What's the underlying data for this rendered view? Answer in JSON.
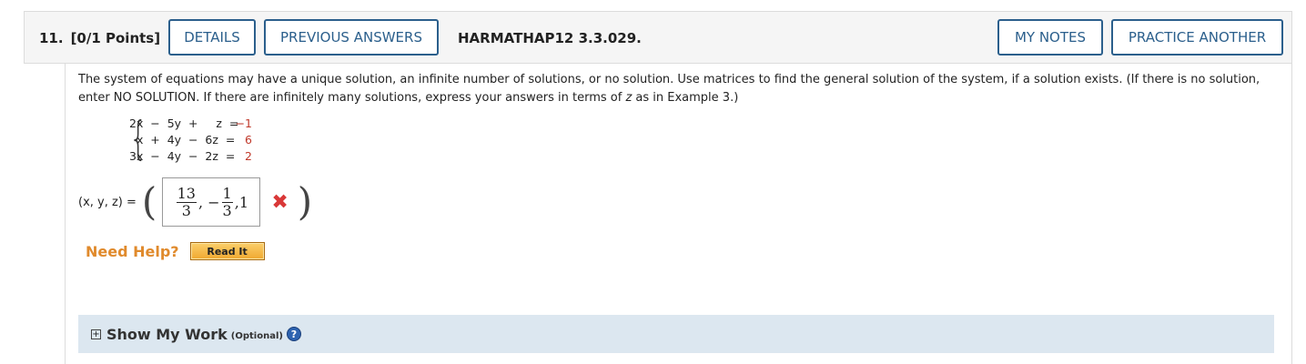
{
  "header": {
    "question_number": "11.",
    "points": "[0/1 Points]",
    "details_label": "DETAILS",
    "previous_answers_label": "PREVIOUS ANSWERS",
    "code": "HARMATHAP12 3.3.029.",
    "my_notes_label": "MY NOTES",
    "practice_another_label": "PRACTICE ANOTHER"
  },
  "prompt": {
    "text_1": "The system of equations may have a unique solution, an infinite number of solutions, or no solution. Use matrices to find the general solution of the system, if a solution exists. (If there is no solution, enter NO SOLUTION. If there are infinitely many solutions, express your answers in terms of ",
    "var": "z",
    "text_2": " as in Example 3.)"
  },
  "system": {
    "equations": [
      {
        "lhs": "2x  −  5y  +     z  =",
        "rhs": "−1"
      },
      {
        "lhs": "  x  +  4y  −  6z  =",
        "rhs": "6"
      },
      {
        "lhs": "3x  −  4y  −  2z  =",
        "rhs": "2"
      }
    ]
  },
  "answer": {
    "label": "(x, y, z) =",
    "frac1_num": "13",
    "frac1_den": "3",
    "sep1": ", −",
    "frac2_num": "1",
    "frac2_den": "3",
    "tail": ",1",
    "status": "incorrect",
    "status_mark": "✖"
  },
  "help": {
    "need_help_label": "Need Help?",
    "read_it_label": "Read It"
  },
  "show_my_work": {
    "expand_icon": "⊞",
    "title": "Show My Work",
    "optional": "(Optional)",
    "help_icon": "?"
  },
  "colors": {
    "button_border": "#2b5f8c",
    "rhs_red": "#c0392b",
    "need_help_orange": "#e08a2c",
    "incorrect_red": "#d93838",
    "work_bg": "#dce7f0"
  }
}
